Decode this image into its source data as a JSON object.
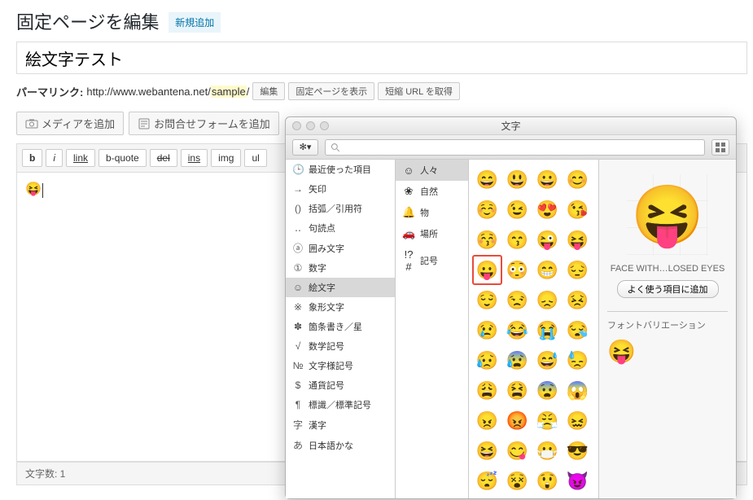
{
  "header": {
    "page_title": "固定ページを編集",
    "add_new": "新規追加"
  },
  "title_input_value": "絵文字テスト",
  "permalink": {
    "label": "パーマリンク:",
    "base": "http://www.webantena.net/",
    "slug": "sample",
    "edit_btn": "編集",
    "view_btn": "固定ページを表示",
    "short_btn": "短縮 URL を取得"
  },
  "media_row": {
    "add_media": "メディアを追加",
    "add_contact": "お問合せフォームを追加"
  },
  "toolbar": {
    "b": "b",
    "i": "i",
    "link": "link",
    "bquote": "b-quote",
    "del": "del",
    "ins": "ins",
    "img": "img",
    "ul": "ul"
  },
  "editor": {
    "content_emoji": "😝"
  },
  "word_count_label": "文字数: 1",
  "char_panel": {
    "title": "文字",
    "search_placeholder": "",
    "sidebar_a": [
      {
        "icon": "🕒",
        "label": "最近使った項目"
      },
      {
        "icon": "→",
        "label": "矢印"
      },
      {
        "icon": "()",
        "label": "括弧／引用符"
      },
      {
        "icon": "‥",
        "label": "句読点"
      },
      {
        "icon": "ⓐ",
        "label": "囲み文字"
      },
      {
        "icon": "①",
        "label": "数字"
      },
      {
        "icon": "☺",
        "label": "絵文字"
      },
      {
        "icon": "※",
        "label": "象形文字"
      },
      {
        "icon": "✽",
        "label": "箇条書き／星"
      },
      {
        "icon": "√",
        "label": "数学記号"
      },
      {
        "icon": "№",
        "label": "文字様記号"
      },
      {
        "icon": "$",
        "label": "通貨記号"
      },
      {
        "icon": "¶",
        "label": "標識／標準記号"
      },
      {
        "icon": "字",
        "label": "漢字"
      },
      {
        "icon": "あ",
        "label": "日本語かな"
      }
    ],
    "sidebar_a_selected": 6,
    "sidebar_b": [
      {
        "icon": "☺",
        "label": "人々"
      },
      {
        "icon": "❀",
        "label": "自然"
      },
      {
        "icon": "🔔",
        "label": "物"
      },
      {
        "icon": "🚗",
        "label": "場所"
      },
      {
        "icon": "!?#",
        "label": "記号"
      }
    ],
    "sidebar_b_selected": 0,
    "emoji_rows": [
      [
        "😄",
        "😃",
        "😀",
        "😊"
      ],
      [
        "☺️",
        "😉",
        "😍",
        "😘"
      ],
      [
        "😚",
        "😙",
        "😜",
        "😝"
      ],
      [
        "😛",
        "😳",
        "😁",
        "😔"
      ],
      [
        "😌",
        "😒",
        "😞",
        "😣"
      ],
      [
        "😢",
        "😂",
        "😭",
        "😪"
      ],
      [
        "😥",
        "😰",
        "😅",
        "😓"
      ],
      [
        "😩",
        "😫",
        "😨",
        "😱"
      ],
      [
        "😠",
        "😡",
        "😤",
        "😖"
      ],
      [
        "😆",
        "😋",
        "😷",
        "😎"
      ],
      [
        "😴",
        "😵",
        "😲",
        "😈"
      ]
    ],
    "selected_rc": [
      3,
      0
    ],
    "preview": {
      "big": "😝",
      "label": "FACE WITH…LOSED EYES",
      "add_btn": "よく使う項目に追加",
      "variation_label": "フォントバリエーション",
      "variation_emoji": "😝"
    }
  }
}
